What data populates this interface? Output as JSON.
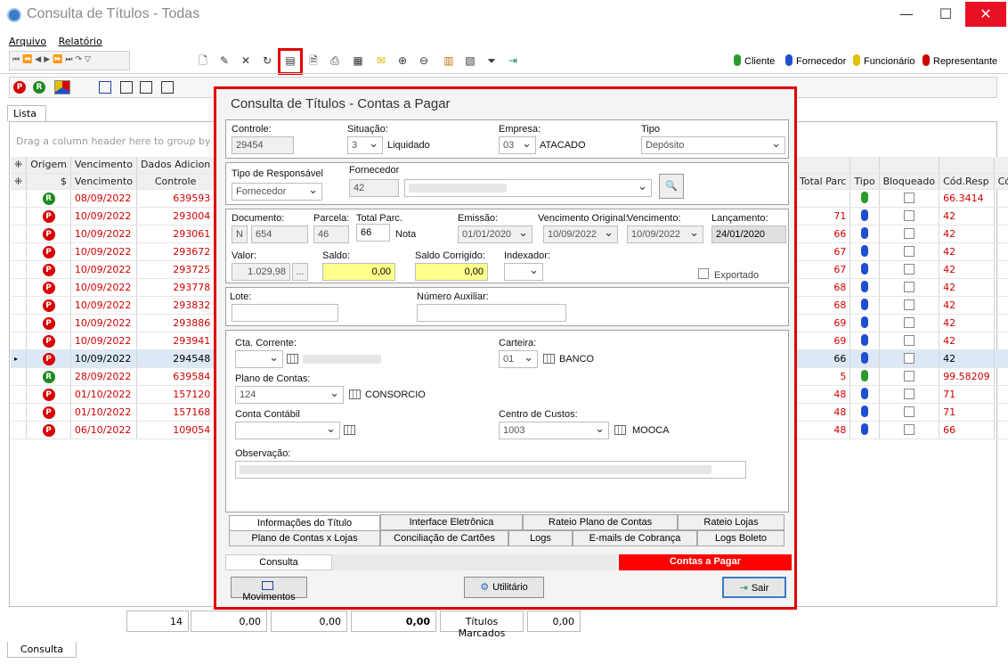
{
  "window": {
    "title": "Consulta de Títulos - Todas",
    "min": "—",
    "max": "☐",
    "close": "✕"
  },
  "menu": [
    "Arquivo",
    "Relatório"
  ],
  "legend": [
    {
      "label": "Cliente",
      "color": "#2a9a2a"
    },
    {
      "label": "Fornecedor",
      "color": "#1f4fd0"
    },
    {
      "label": "Funcionário",
      "color": "#e0c000"
    },
    {
      "label": "Representante",
      "color": "#d00000"
    }
  ],
  "tabs": {
    "lista": "Lista"
  },
  "grid": {
    "group_hint": "Drag a column header here to group by that c",
    "headers_top": [
      "Origem",
      "Vencimento",
      "Dados Adicion"
    ],
    "headers": [
      "$",
      "Vencimento",
      "Controle"
    ],
    "right_headers": [
      "Total Parc",
      "Tipo",
      "Bloqueado",
      "Cód.Resp",
      "Có"
    ],
    "rows": [
      {
        "origin": "R",
        "venc": "08/09/2022",
        "ctrl": "639593",
        "total": "",
        "tipo": "#2a9a2a",
        "cod": "66.3414"
      },
      {
        "origin": "P",
        "venc": "10/09/2022",
        "ctrl": "293004",
        "total": "71",
        "tipo": "#1f4fd0",
        "cod": "42"
      },
      {
        "origin": "P",
        "venc": "10/09/2022",
        "ctrl": "293061",
        "total": "66",
        "tipo": "#1f4fd0",
        "cod": "42"
      },
      {
        "origin": "P",
        "venc": "10/09/2022",
        "ctrl": "293672",
        "total": "67",
        "tipo": "#1f4fd0",
        "cod": "42"
      },
      {
        "origin": "P",
        "venc": "10/09/2022",
        "ctrl": "293725",
        "total": "67",
        "tipo": "#1f4fd0",
        "cod": "42"
      },
      {
        "origin": "P",
        "venc": "10/09/2022",
        "ctrl": "293778",
        "total": "68",
        "tipo": "#1f4fd0",
        "cod": "42"
      },
      {
        "origin": "P",
        "venc": "10/09/2022",
        "ctrl": "293832",
        "total": "68",
        "tipo": "#1f4fd0",
        "cod": "42"
      },
      {
        "origin": "P",
        "venc": "10/09/2022",
        "ctrl": "293886",
        "total": "69",
        "tipo": "#1f4fd0",
        "cod": "42"
      },
      {
        "origin": "P",
        "venc": "10/09/2022",
        "ctrl": "293941",
        "total": "69",
        "tipo": "#1f4fd0",
        "cod": "42"
      },
      {
        "origin": "P",
        "venc": "10/09/2022",
        "ctrl": "294548",
        "total": "66",
        "tipo": "#1f4fd0",
        "cod": "42",
        "selected": true
      },
      {
        "origin": "R",
        "venc": "28/09/2022",
        "ctrl": "639584",
        "total": "5",
        "tipo": "#2a9a2a",
        "cod": "99.58209"
      },
      {
        "origin": "P",
        "venc": "01/10/2022",
        "ctrl": "157120",
        "total": "48",
        "tipo": "#1f4fd0",
        "cod": "71"
      },
      {
        "origin": "P",
        "venc": "01/10/2022",
        "ctrl": "157168",
        "total": "48",
        "tipo": "#1f4fd0",
        "cod": "71"
      },
      {
        "origin": "P",
        "venc": "06/10/2022",
        "ctrl": "109054",
        "total": "48",
        "tipo": "#1f4fd0",
        "cod": "66"
      }
    ]
  },
  "footer": {
    "count": "14",
    "v1": "0,00",
    "v2": "0,00",
    "v3": "0,00",
    "marked_label": "Títulos Marcados",
    "v4": "0,00"
  },
  "status_tab": "Consulta",
  "dialog": {
    "title": "Consulta de Títulos - Contas a Pagar",
    "controle_label": "Controle:",
    "controle": "29454",
    "situacao_label": "Situação:",
    "situacao": "3",
    "situacao_text": "Liquidado",
    "empresa_label": "Empresa:",
    "empresa": "03",
    "empresa_text": "ATACADO",
    "tipo_label": "Tipo",
    "tipo": "Depósito",
    "tiporesp_label": "Tipo de Responsável",
    "tiporesp": "Fornecedor",
    "fornecedor_label": "Fornecedor",
    "fornecedor": "42",
    "documento_label": "Documento:",
    "doc_prefix": "N",
    "documento": "654",
    "parcela_label": "Parcela:",
    "parcela": "46",
    "totalparc_label": "Total Parc.",
    "totalparc": "66",
    "nota": "Nota",
    "emissao_label": "Emissão:",
    "emissao": "01/01/2020",
    "vencorig_label": "Vencimento Original:",
    "vencorig": "10/09/2022",
    "venc_label": "Vencimento:",
    "venc": "10/09/2022",
    "lanc_label": "Lançamento:",
    "lanc": "24/01/2020",
    "valor_label": "Valor:",
    "valor": "1.029,98",
    "valor_btn": "...",
    "saldo_label": "Saldo:",
    "saldo": "0,00",
    "saldocor_label": "Saldo Corrigido:",
    "saldocor": "0,00",
    "indexador_label": "Indexador:",
    "exportado": "Exportado",
    "lote_label": "Lote:",
    "numaux_label": "Número Auxiliar:",
    "cta_label": "Cta. Corrente:",
    "carteira_label": "Carteira:",
    "carteira": "01",
    "carteira_text": "BANCO",
    "plano_label": "Plano de Contas:",
    "plano": "124",
    "plano_text": "CONSORCIO",
    "contacontabil_label": "Conta Contábil",
    "centro_label": "Centro de Custos:",
    "centro": "1003",
    "centro_text": "MOOCA",
    "obs_label": "Observação:",
    "tabs1": [
      "Informações do Título",
      "Interface Eletrônica",
      "Rateio Plano de Contas",
      "Rateio Lojas"
    ],
    "tabs2": [
      "Plano de Contas x Lojas",
      "Conciliação de Cartões",
      "Logs",
      "E-mails de Cobrança",
      "Logs Boleto"
    ],
    "bottom_tab": "Consulta",
    "bottom_banner": "Contas a Pagar",
    "btn_mov": "Movimentos",
    "btn_util": "Utilitário",
    "btn_sair": "Sair"
  }
}
